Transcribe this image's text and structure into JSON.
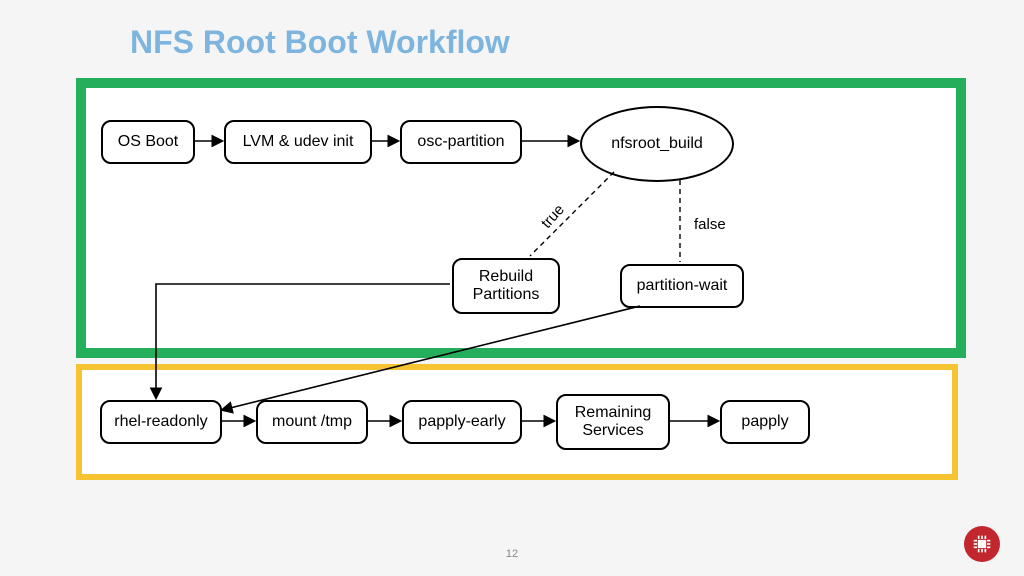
{
  "title": "NFS Root Boot Workflow",
  "page_number": "12",
  "zones": {
    "green_border": "#25af5c",
    "yellow_border": "#f7c431"
  },
  "nodes": {
    "os_boot": "OS Boot",
    "lvm_udev": "LVM & udev init",
    "osc_partition": "osc-partition",
    "nfsroot_build": "nfsroot_build",
    "rebuild_partitions": "Rebuild\nPartitions",
    "partition_wait": "partition-wait",
    "rhel_readonly": "rhel-readonly",
    "mount_tmp": "mount /tmp",
    "papply_early": "papply-early",
    "remaining_services": "Remaining\nServices",
    "papply": "papply"
  },
  "edges": {
    "decision_true": "true",
    "decision_false": "false"
  },
  "chart_data": {
    "type": "flowchart",
    "title": "NFS Root Boot Workflow",
    "groups": [
      {
        "id": "green",
        "color": "#25af5c",
        "nodes": [
          "os_boot",
          "lvm_udev",
          "osc_partition",
          "nfsroot_build",
          "rebuild_partitions",
          "partition_wait"
        ]
      },
      {
        "id": "yellow",
        "color": "#f7c431",
        "nodes": [
          "rhel_readonly",
          "mount_tmp",
          "papply_early",
          "remaining_services",
          "papply"
        ]
      }
    ],
    "nodes": [
      {
        "id": "os_boot",
        "label": "OS Boot",
        "shape": "rect"
      },
      {
        "id": "lvm_udev",
        "label": "LVM & udev init",
        "shape": "rect"
      },
      {
        "id": "osc_partition",
        "label": "osc-partition",
        "shape": "rect"
      },
      {
        "id": "nfsroot_build",
        "label": "nfsroot_build",
        "shape": "ellipse"
      },
      {
        "id": "rebuild_partitions",
        "label": "Rebuild Partitions",
        "shape": "rect"
      },
      {
        "id": "partition_wait",
        "label": "partition-wait",
        "shape": "rect"
      },
      {
        "id": "rhel_readonly",
        "label": "rhel-readonly",
        "shape": "rect"
      },
      {
        "id": "mount_tmp",
        "label": "mount /tmp",
        "shape": "rect"
      },
      {
        "id": "papply_early",
        "label": "papply-early",
        "shape": "rect"
      },
      {
        "id": "remaining_services",
        "label": "Remaining Services",
        "shape": "rect"
      },
      {
        "id": "papply",
        "label": "papply",
        "shape": "rect"
      }
    ],
    "edges": [
      {
        "from": "os_boot",
        "to": "lvm_udev",
        "style": "solid"
      },
      {
        "from": "lvm_udev",
        "to": "osc_partition",
        "style": "solid"
      },
      {
        "from": "osc_partition",
        "to": "nfsroot_build",
        "style": "solid"
      },
      {
        "from": "nfsroot_build",
        "to": "rebuild_partitions",
        "style": "dashed",
        "label": "true"
      },
      {
        "from": "nfsroot_build",
        "to": "partition_wait",
        "style": "dashed",
        "label": "false"
      },
      {
        "from": "rebuild_partitions",
        "to": "rhel_readonly",
        "style": "solid"
      },
      {
        "from": "partition_wait",
        "to": "rhel_readonly",
        "style": "solid"
      },
      {
        "from": "rhel_readonly",
        "to": "mount_tmp",
        "style": "solid"
      },
      {
        "from": "mount_tmp",
        "to": "papply_early",
        "style": "solid"
      },
      {
        "from": "papply_early",
        "to": "remaining_services",
        "style": "solid"
      },
      {
        "from": "remaining_services",
        "to": "papply",
        "style": "solid"
      }
    ]
  }
}
